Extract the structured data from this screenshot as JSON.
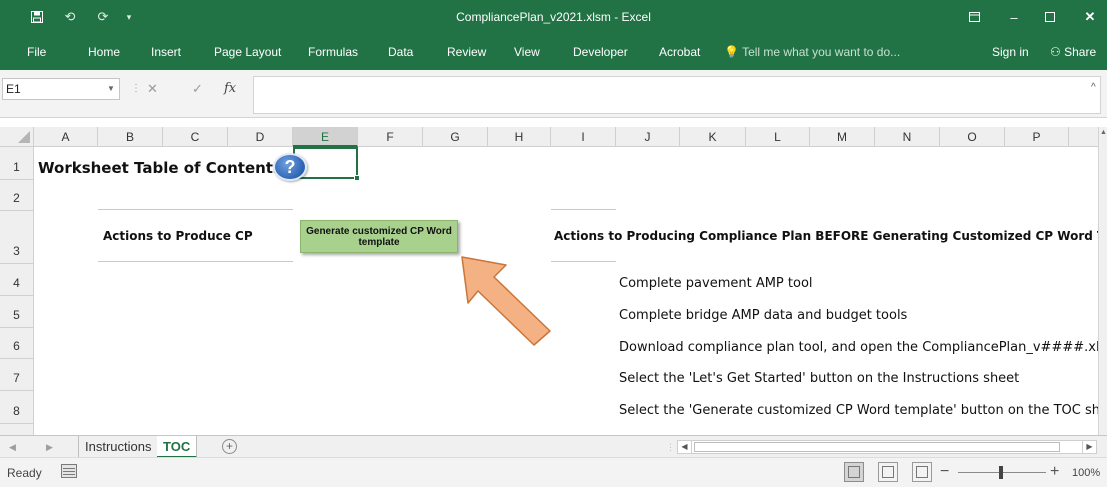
{
  "window": {
    "title": "CompliancePlan_v2021.xlsm - Excel",
    "accent_color": "#217346"
  },
  "quick_access": {
    "save_icon": "save-icon",
    "undo_icon": "undo-icon",
    "redo_icon": "redo-icon",
    "customize_icon": "customize-qat-icon"
  },
  "ribbon": {
    "tabs": [
      "File",
      "Home",
      "Insert",
      "Page Layout",
      "Formulas",
      "Data",
      "Review",
      "View",
      "Developer",
      "Acrobat"
    ],
    "tell_me": "Tell me what you want to do...",
    "sign_in": "Sign in",
    "share": "Share"
  },
  "formula_bar": {
    "name_box": "E1",
    "formula": "",
    "fx_label": "fx"
  },
  "grid": {
    "columns": [
      "A",
      "B",
      "C",
      "D",
      "E",
      "F",
      "G",
      "H",
      "I",
      "J",
      "K",
      "L",
      "M",
      "N",
      "O",
      "P"
    ],
    "selected_column": "E",
    "rows": [
      "1",
      "2",
      "3",
      "4",
      "5",
      "6",
      "7",
      "8"
    ],
    "cells": {
      "title": "Worksheet Table of Contents",
      "actions_header": "Actions to Produce CP",
      "actions_before_header": "Actions to Producing Compliance Plan BEFORE Generating Customized CP Word Template",
      "steps": [
        "Complete pavement AMP tool",
        "Complete bridge AMP data and budget tools",
        "Download compliance plan tool, and open the CompliancePlan_v####.xlsm workbe",
        "Select the 'Let's Get Started' button on the Instructions sheet",
        "Select the 'Generate customized CP Word template' button on the TOC sheet"
      ]
    },
    "help_button": "?",
    "generate_button": "Generate customized CP Word template",
    "generate_button_color": "#a9d18e",
    "arrow_color": "#f4b183"
  },
  "sheets": {
    "tabs": [
      "Instructions",
      "TOC"
    ],
    "active": "TOC"
  },
  "status": {
    "ready": "Ready",
    "zoom": "100%"
  }
}
